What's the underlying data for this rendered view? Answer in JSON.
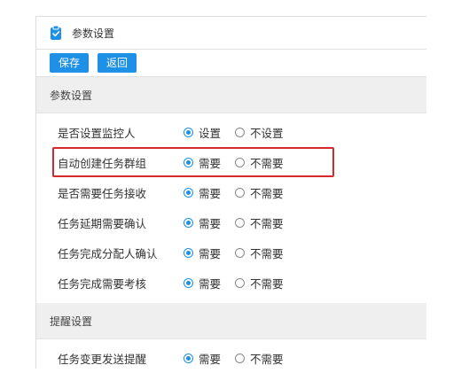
{
  "panel": {
    "title": "参数设置",
    "title_icon": "clipboard-check-icon"
  },
  "toolbar": {
    "save_label": "保存",
    "back_label": "返回"
  },
  "colors": {
    "accent": "#1e90e6",
    "highlight": "#d8282a"
  },
  "sections": [
    {
      "title": "参数设置",
      "rows": [
        {
          "label": "是否设置监控人",
          "option1": "设置",
          "option2": "不设置",
          "selected": "option1"
        },
        {
          "label": "自动创建任务群组",
          "option1": "需要",
          "option2": "不需要",
          "selected": "option1"
        },
        {
          "label": "是否需要任务接收",
          "option1": "需要",
          "option2": "不需要",
          "selected": "option1"
        },
        {
          "label": "任务延期需要确认",
          "option1": "需要",
          "option2": "不需要",
          "selected": "option1"
        },
        {
          "label": "任务完成分配人确认",
          "option1": "需要",
          "option2": "不需要",
          "selected": "option1"
        },
        {
          "label": "任务完成需要考核",
          "option1": "需要",
          "option2": "不需要",
          "selected": "option1"
        }
      ]
    },
    {
      "title": "提醒设置",
      "rows": [
        {
          "label": "任务变更发送提醒",
          "option1": "需要",
          "option2": "不需要",
          "selected": "option1"
        }
      ]
    }
  ]
}
